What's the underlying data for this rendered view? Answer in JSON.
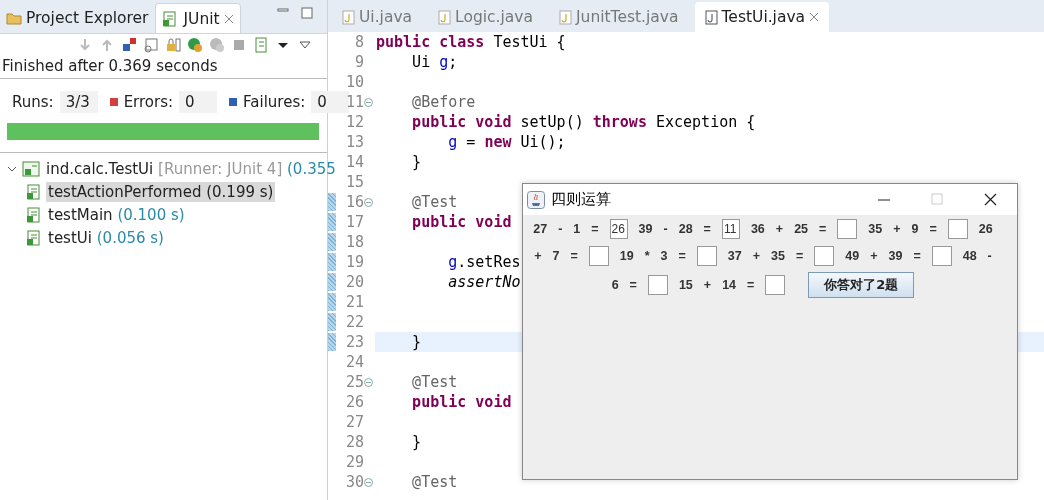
{
  "left_panel": {
    "tabs": [
      {
        "label": "Project Explorer",
        "selected": false
      },
      {
        "label": "JUnit",
        "selected": true
      }
    ],
    "status": "Finished after 0.369 seconds",
    "counters": [
      {
        "kind": "runs",
        "label": "Runs:",
        "value": "3/3"
      },
      {
        "kind": "errors",
        "label": "Errors:",
        "value": "0"
      },
      {
        "kind": "failures",
        "label": "Failures:",
        "value": "0"
      }
    ],
    "progress": {
      "level": 1
    },
    "tree": [
      {
        "name": "ind.calc.TestUi",
        "runner": "[Runner: JUnit 4]",
        "time": "(0.355",
        "expanded": true,
        "selected": false,
        "children": [
          {
            "name": "testActionPerformed",
            "time": "(0.199 s)",
            "selected": true
          },
          {
            "name": "testMain",
            "time": "(0.100 s)",
            "selected": false
          },
          {
            "name": "testUi",
            "time": "(0.056 s)",
            "selected": false
          }
        ]
      }
    ]
  },
  "editor": {
    "tabs": [
      {
        "label": "Ui.java",
        "selected": false
      },
      {
        "label": "Logic.java",
        "selected": false
      },
      {
        "label": "JunitTest.java",
        "selected": false
      },
      {
        "label": "TestUi.java",
        "selected": true
      }
    ],
    "lines": [
      {
        "number": "8",
        "fold": false,
        "changed": false,
        "current": false,
        "tokens": [
          {
            "kind": "keyword",
            "text": "public class"
          },
          {
            "kind": "plain",
            "text": " TestUi {"
          }
        ]
      },
      {
        "number": "9",
        "fold": false,
        "changed": false,
        "current": false,
        "tokens": [
          {
            "kind": "plain",
            "text": "    Ui "
          },
          {
            "kind": "field",
            "text": "g"
          },
          {
            "kind": "plain",
            "text": ";"
          }
        ]
      },
      {
        "number": "10",
        "fold": false,
        "changed": false,
        "current": false
      },
      {
        "number": "11",
        "fold": true,
        "changed": false,
        "current": false,
        "tokens": [
          {
            "kind": "annotation",
            "text": "    @Before"
          }
        ]
      },
      {
        "number": "12",
        "fold": false,
        "changed": false,
        "current": false,
        "tokens": [
          {
            "kind": "keyword",
            "text": "    public void"
          },
          {
            "kind": "plain",
            "text": " setUp() "
          },
          {
            "kind": "keyword",
            "text": "throws"
          },
          {
            "kind": "plain",
            "text": " Exception {"
          }
        ]
      },
      {
        "number": "13",
        "fold": false,
        "changed": false,
        "current": false,
        "tokens": [
          {
            "kind": "field",
            "text": "        g"
          },
          {
            "kind": "plain",
            "text": " = "
          },
          {
            "kind": "keyword",
            "text": "new"
          },
          {
            "kind": "plain",
            "text": " Ui();"
          }
        ]
      },
      {
        "number": "14",
        "fold": false,
        "changed": false,
        "current": false,
        "tokens": [
          {
            "kind": "plain",
            "text": "    }"
          }
        ]
      },
      {
        "number": "15",
        "fold": false,
        "changed": false,
        "current": false
      },
      {
        "number": "16",
        "fold": true,
        "changed": true,
        "current": false,
        "tokens": [
          {
            "kind": "annotation",
            "text": "    @Test"
          }
        ]
      },
      {
        "number": "17",
        "fold": false,
        "changed": true,
        "current": false,
        "tokens": [
          {
            "kind": "keyword",
            "text": "    public void"
          }
        ]
      },
      {
        "number": "18",
        "fold": false,
        "changed": true,
        "current": false
      },
      {
        "number": "19",
        "fold": false,
        "changed": true,
        "current": false,
        "tokens": [
          {
            "kind": "field",
            "text": "        g"
          },
          {
            "kind": "plain",
            "text": ".setRes"
          }
        ]
      },
      {
        "number": "20",
        "fold": false,
        "changed": true,
        "current": false,
        "tokens": [
          {
            "kind": "italic",
            "text": "        assertNo"
          }
        ]
      },
      {
        "number": "21",
        "fold": false,
        "changed": true,
        "current": false
      },
      {
        "number": "22",
        "fold": false,
        "changed": true,
        "current": false
      },
      {
        "number": "23",
        "fold": false,
        "changed": true,
        "current": true,
        "tokens": [
          {
            "kind": "plain",
            "text": "    }"
          }
        ]
      },
      {
        "number": "24",
        "fold": false,
        "changed": false,
        "current": false
      },
      {
        "number": "25",
        "fold": true,
        "changed": false,
        "current": false,
        "tokens": [
          {
            "kind": "annotation",
            "text": "    @Test"
          }
        ]
      },
      {
        "number": "26",
        "fold": false,
        "changed": false,
        "current": false,
        "tokens": [
          {
            "kind": "keyword",
            "text": "    public void"
          }
        ]
      },
      {
        "number": "27",
        "fold": false,
        "changed": false,
        "current": false
      },
      {
        "number": "28",
        "fold": false,
        "changed": false,
        "current": false,
        "tokens": [
          {
            "kind": "plain",
            "text": "    }"
          }
        ]
      },
      {
        "number": "29",
        "fold": false,
        "changed": false,
        "current": false
      },
      {
        "number": "30",
        "fold": true,
        "changed": false,
        "current": false,
        "tokens": [
          {
            "kind": "annotation",
            "text": "    @Test"
          }
        ]
      }
    ]
  },
  "dialog": {
    "title": "四则运算",
    "items": [
      {
        "kind": "text",
        "text": "27"
      },
      {
        "kind": "text",
        "text": "-"
      },
      {
        "kind": "text",
        "text": "1"
      },
      {
        "kind": "text",
        "text": "="
      },
      {
        "kind": "field",
        "value": "26"
      },
      {
        "kind": "text",
        "text": "39"
      },
      {
        "kind": "text",
        "text": "-"
      },
      {
        "kind": "text",
        "text": "28"
      },
      {
        "kind": "text",
        "text": "="
      },
      {
        "kind": "field",
        "value": "11"
      },
      {
        "kind": "text",
        "text": "36"
      },
      {
        "kind": "text",
        "text": "+"
      },
      {
        "kind": "text",
        "text": "25"
      },
      {
        "kind": "text",
        "text": "="
      },
      {
        "kind": "field"
      },
      {
        "kind": "text",
        "text": "35"
      },
      {
        "kind": "text",
        "text": "+"
      },
      {
        "kind": "text",
        "text": "9"
      },
      {
        "kind": "text",
        "text": "="
      },
      {
        "kind": "field"
      },
      {
        "kind": "text",
        "text": "26"
      },
      {
        "kind": "text",
        "text": "+"
      },
      {
        "kind": "text",
        "text": "7"
      },
      {
        "kind": "text",
        "text": "="
      },
      {
        "kind": "field"
      },
      {
        "kind": "text",
        "text": "19"
      },
      {
        "kind": "text",
        "text": "*"
      },
      {
        "kind": "text",
        "text": "3"
      },
      {
        "kind": "text",
        "text": "="
      },
      {
        "kind": "field"
      },
      {
        "kind": "text",
        "text": "37"
      },
      {
        "kind": "text",
        "text": "+"
      },
      {
        "kind": "text",
        "text": "35"
      },
      {
        "kind": "text",
        "text": "="
      },
      {
        "kind": "field"
      },
      {
        "kind": "text",
        "text": "49"
      },
      {
        "kind": "text",
        "text": "+"
      },
      {
        "kind": "text",
        "text": "39"
      },
      {
        "kind": "text",
        "text": "="
      },
      {
        "kind": "field"
      },
      {
        "kind": "text",
        "text": "48"
      },
      {
        "kind": "text",
        "text": "-"
      },
      {
        "kind": "text",
        "text": "6"
      },
      {
        "kind": "text",
        "text": "="
      },
      {
        "kind": "field"
      },
      {
        "kind": "text",
        "text": "15"
      },
      {
        "kind": "text",
        "text": "+"
      },
      {
        "kind": "text",
        "text": "14"
      },
      {
        "kind": "text",
        "text": "="
      },
      {
        "kind": "field"
      },
      {
        "kind": "button",
        "text": "你答对了2题"
      }
    ]
  }
}
